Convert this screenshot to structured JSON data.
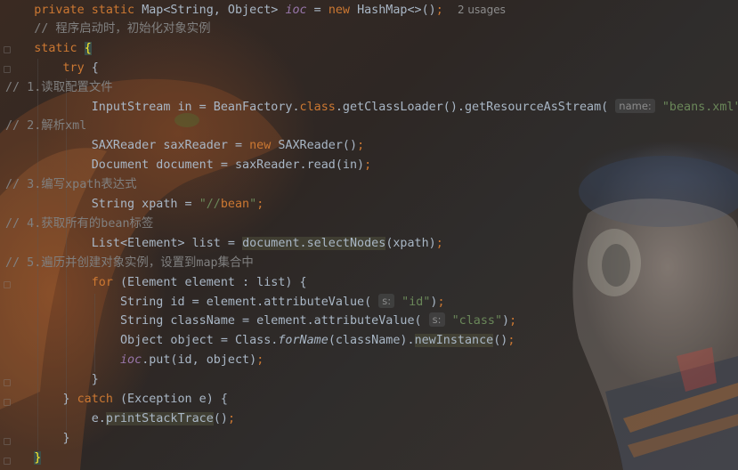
{
  "editor": {
    "lines": [
      {
        "id": "l1",
        "segs": [
          {
            "t": "    "
          },
          {
            "t": "private static ",
            "c": "kw"
          },
          {
            "t": "Map<String, Object> "
          },
          {
            "t": "ioc",
            "c": "fld"
          },
          {
            "t": " = "
          },
          {
            "t": "new ",
            "c": "kw"
          },
          {
            "t": "HashMap<>()"
          },
          {
            "t": ";",
            "c": "kw"
          },
          {
            "t": "  "
          },
          {
            "t": "2 usages",
            "c": "hint"
          }
        ]
      },
      {
        "id": "l2",
        "segs": [
          {
            "t": "    "
          },
          {
            "t": "// 程序启动时，初始化对象实例",
            "c": "cmt"
          }
        ]
      },
      {
        "id": "l3",
        "segs": [
          {
            "t": "    "
          },
          {
            "t": "static ",
            "c": "kw"
          },
          {
            "t": "{",
            "c": "brace-hl"
          }
        ]
      },
      {
        "id": "l4",
        "segs": [
          {
            "t": "        "
          },
          {
            "t": "try ",
            "c": "kw"
          },
          {
            "t": "{"
          }
        ]
      },
      {
        "id": "l5",
        "segs": [
          {
            "t": "// 1.读取配置文件",
            "c": "cmt"
          }
        ]
      },
      {
        "id": "l6",
        "segs": [
          {
            "t": "            "
          },
          {
            "t": "InputStream in = BeanFactory."
          },
          {
            "t": "class",
            "c": "kw"
          },
          {
            "t": ".getClassLoader().getResourceAsStream( "
          },
          {
            "t": "name:",
            "c": "param"
          },
          {
            "t": " "
          },
          {
            "t": "\"beans.xml\"",
            "c": "str"
          },
          {
            "t": ")"
          },
          {
            "t": ";",
            "c": "kw"
          }
        ]
      },
      {
        "id": "l7",
        "segs": [
          {
            "t": "// 2.解析xml",
            "c": "cmt"
          }
        ]
      },
      {
        "id": "l8",
        "segs": [
          {
            "t": "            "
          },
          {
            "t": "SAXReader saxReader = "
          },
          {
            "t": "new ",
            "c": "kw"
          },
          {
            "t": "SAXReader()"
          },
          {
            "t": ";",
            "c": "kw"
          }
        ]
      },
      {
        "id": "l9",
        "segs": [
          {
            "t": "            "
          },
          {
            "t": "Document document = saxReader.read(in)"
          },
          {
            "t": ";",
            "c": "kw"
          }
        ]
      },
      {
        "id": "l10",
        "segs": [
          {
            "t": "// 3.编写xpath表达式",
            "c": "cmt"
          }
        ]
      },
      {
        "id": "l11",
        "segs": [
          {
            "t": "            "
          },
          {
            "t": "String xpath = "
          },
          {
            "t": "\"//",
            "c": "str"
          },
          {
            "t": "bean",
            "c": "kw"
          },
          {
            "t": "\"",
            "c": "str"
          },
          {
            "t": ";",
            "c": "kw"
          }
        ]
      },
      {
        "id": "l12",
        "segs": [
          {
            "t": "// 4.获取所有的bean标签",
            "c": "cmt"
          }
        ]
      },
      {
        "id": "l13",
        "segs": [
          {
            "t": "            "
          },
          {
            "t": "List<Element> list = "
          },
          {
            "t": "document.selectNodes",
            "c": "hl"
          },
          {
            "t": "(xpath)"
          },
          {
            "t": ";",
            "c": "kw"
          }
        ]
      },
      {
        "id": "l14",
        "segs": [
          {
            "t": "// 5.遍历并创建对象实例，设置到map集合中",
            "c": "cmt"
          }
        ]
      },
      {
        "id": "l15",
        "segs": [
          {
            "t": "            "
          },
          {
            "t": "for ",
            "c": "kw"
          },
          {
            "t": "(Element element : list) {"
          }
        ]
      },
      {
        "id": "l16",
        "segs": [
          {
            "t": "                "
          },
          {
            "t": "String id = element.attributeValue( "
          },
          {
            "t": "s:",
            "c": "param"
          },
          {
            "t": " "
          },
          {
            "t": "\"id\"",
            "c": "str"
          },
          {
            "t": ")"
          },
          {
            "t": ";",
            "c": "kw"
          }
        ]
      },
      {
        "id": "l17",
        "segs": [
          {
            "t": "                "
          },
          {
            "t": "String className = element.attributeValue( "
          },
          {
            "t": "s:",
            "c": "param"
          },
          {
            "t": " "
          },
          {
            "t": "\"class\"",
            "c": "str"
          },
          {
            "t": ")"
          },
          {
            "t": ";",
            "c": "kw"
          }
        ]
      },
      {
        "id": "l18",
        "segs": [
          {
            "t": "                "
          },
          {
            "t": "Object object = Class."
          },
          {
            "t": "forName",
            "c": "ital"
          },
          {
            "t": "(className)."
          },
          {
            "t": "newInstance",
            "c": "hl"
          },
          {
            "t": "()"
          },
          {
            "t": ";",
            "c": "kw"
          }
        ]
      },
      {
        "id": "l19",
        "segs": [
          {
            "t": "                "
          },
          {
            "t": "ioc",
            "c": "fld"
          },
          {
            "t": ".put(id, object)"
          },
          {
            "t": ";",
            "c": "kw"
          }
        ]
      },
      {
        "id": "l20",
        "segs": [
          {
            "t": "            "
          },
          {
            "t": "}"
          }
        ]
      },
      {
        "id": "l21",
        "segs": [
          {
            "t": "        "
          },
          {
            "t": "} "
          },
          {
            "t": "catch ",
            "c": "kw"
          },
          {
            "t": "(Exception e) {"
          }
        ]
      },
      {
        "id": "l22",
        "segs": [
          {
            "t": "            "
          },
          {
            "t": "e."
          },
          {
            "t": "printStackTrace",
            "c": "hl"
          },
          {
            "t": "()"
          },
          {
            "t": ";",
            "c": "kw"
          }
        ]
      },
      {
        "id": "l23",
        "segs": [
          {
            "t": "        "
          },
          {
            "t": "}"
          }
        ]
      },
      {
        "id": "l24",
        "segs": [
          {
            "t": "    "
          },
          {
            "t": "}",
            "c": "brace-hl"
          }
        ]
      }
    ]
  }
}
